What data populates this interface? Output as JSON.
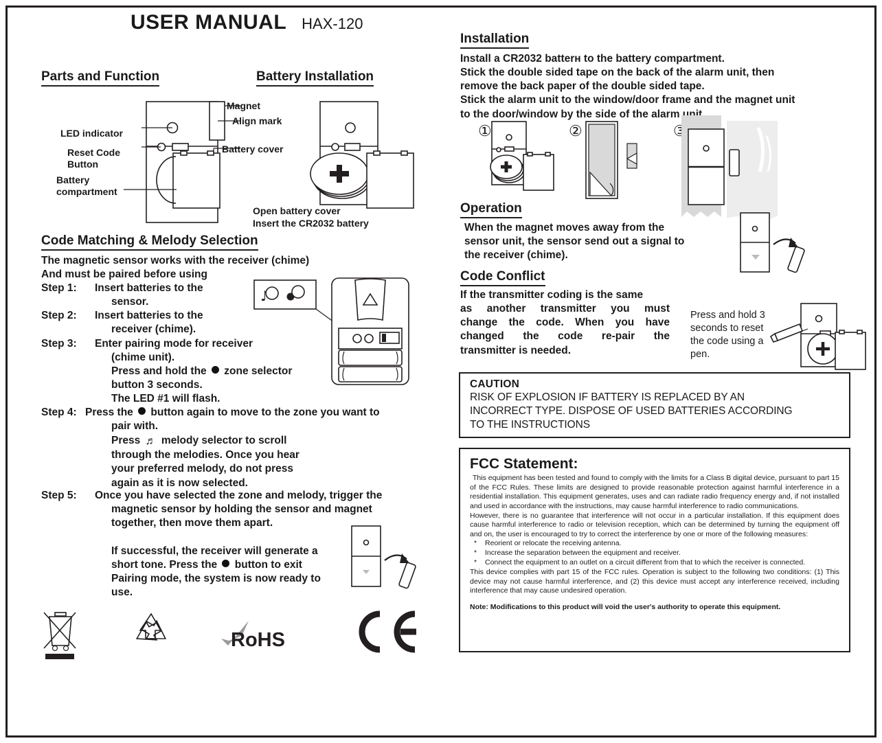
{
  "header": {
    "title": "USER MANUAL",
    "model": "HAX-120"
  },
  "sections": {
    "parts": {
      "heading": "Parts and Function",
      "labels": {
        "magnet": "Magnet",
        "align_mark": "Align mark",
        "led_indicator": "LED indicator",
        "reset_code_button": "Reset Code\nButton",
        "battery_compartment": "Battery\ncompartment",
        "battery_cover": "Battery cover"
      }
    },
    "battery_installation": {
      "heading": "Battery Installation",
      "caption_line1": "Open battery cover",
      "caption_line2": "Insert the CR2032 battery"
    },
    "code_matching": {
      "heading": "Code Matching & Melody Selection",
      "intro_line1": "The magnetic sensor works with the receiver (chime)",
      "intro_line2": "And must be paired before using",
      "steps": [
        {
          "label": "Step 1:",
          "lines": [
            "Insert batteries to the",
            "sensor."
          ]
        },
        {
          "label": "Step 2:",
          "lines": [
            "Insert batteries to the",
            "receiver (chime)."
          ]
        },
        {
          "label": "Step 3:",
          "lines": [
            "Enter pairing mode for receiver",
            "(chime unit).",
            "Press and hold the ● zone selector",
            "button 3 seconds.",
            "The LED #1 will flash."
          ]
        },
        {
          "label": "Step 4:",
          "lines": [
            "Press the ● button again to move to the zone you want to",
            "pair with.",
            "Press ♬ melody selector to scroll",
            "through the melodies. Once you hear",
            "your preferred melody, do not press",
            "again as it is now selected."
          ]
        },
        {
          "label": "Step 5:",
          "lines": [
            "Once you have selected the zone and melody, trigger the",
            "magnetic sensor by holding the sensor and magnet",
            "together, then move them apart.",
            "",
            "If successful, the receiver will generate a",
            "short tone. Press the ● button to exit",
            "Pairing mode, the system is now ready to",
            "use."
          ]
        }
      ]
    },
    "installation": {
      "heading": "Installation",
      "lines": [
        "Install a CR2032 batterн to the battery compartment.",
        "Stick the double sided tape on the back of the alarm unit, then",
        "remove the back paper of the double sided tape.",
        "Stick the alarm unit to the window/door frame and the magnet unit",
        "to the door/window by the side of the alarm unit.."
      ],
      "step_numbers": [
        "①",
        "②",
        "③"
      ]
    },
    "operation": {
      "heading": "Operation",
      "lines": [
        "When the magnet moves away from the",
        "sensor unit, the sensor send out a signal to",
        "the receiver (chime)."
      ]
    },
    "code_conflict": {
      "heading": "Code Conflict",
      "lines": [
        "If the transmitter coding is the same",
        "as another transmitter you must",
        "change the code. When you have",
        "changed the code re-pair the",
        "transmitter is needed."
      ],
      "reset_note": [
        "Press and hold 3",
        "seconds to reset",
        "the code using a",
        "pen."
      ]
    },
    "caution": {
      "title": "CAUTION",
      "lines": [
        "RISK OF EXPLOSION IF BATTERY IS REPLACED BY AN",
        "INCORRECT TYPE. DISPOSE OF USED BATTERIES ACCORDING",
        "TO THE INSTRUCTIONS"
      ]
    },
    "fcc": {
      "title": "FCC Statement:",
      "para1": "This equipment has been tested and found to comply with the limits for a Class B digital device, pursuant to part 15 of the FCC Rules.  These limits are designed to provide reasonable protection against harmful interference in a residential installation. This equipment generates, uses and can radiate radio frequency energy and, if not installed and used in accordance with the instructions, may cause harmful interference to radio communications.",
      "para2": "However, there is no guarantee that interference will not occur in a particular installation. If this equipment does cause harmful interference to radio or television reception, which can be determined by turning the equipment off and on, the user is encouraged to try to correct the interference by one or more of the following measures:",
      "bullets": [
        "Reorient or relocate the receiving antenna.",
        "Increase the separation between the equipment and receiver.",
        "Connect the equipment to an outlet on a circuit different from that to which the receiver is connected."
      ],
      "bullet_marker": "*",
      "para3": "This device complies with part 15 of the FCC rules. Operation is subject to the following two conditions: (1) This device may not cause harmful interference, and (2) this device must accept any interference received, including interference that may cause undesired operation.",
      "note": "Note: Modifications to this product will void the user's authority to operate this equipment."
    },
    "compliance_marks": {
      "weee": "weee-crossed-bin-icon",
      "recycle": "recycling-mobius-icon",
      "rohs": "RoHS",
      "ce": "ce-mark-icon"
    }
  }
}
